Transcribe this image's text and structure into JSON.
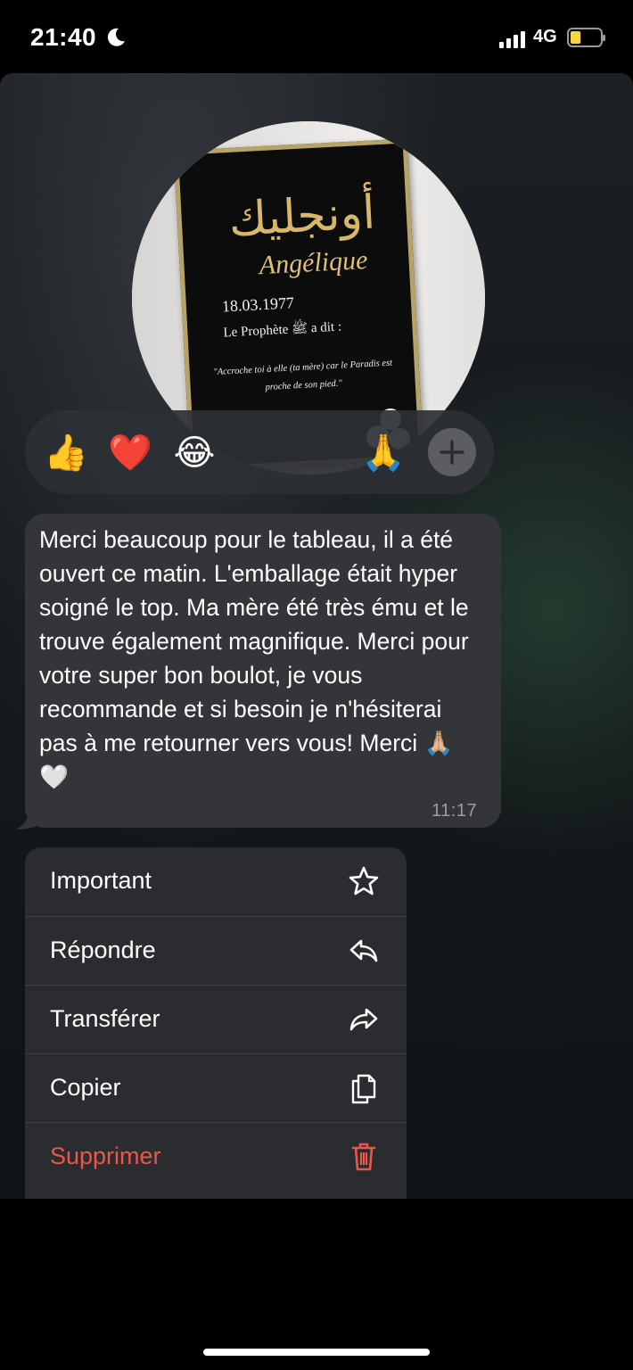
{
  "status_bar": {
    "time": "21:40",
    "network": "4G",
    "battery_level_fraction": 0.35,
    "battery_color": "#f5d547",
    "icons": [
      "moon-icon",
      "signal-icon",
      "battery-icon"
    ]
  },
  "image_preview": {
    "arabic_title": "أونجليك",
    "name": "Angélique",
    "date": "18.03.1977",
    "said_line": "Le Prophète ﷺ a dit :",
    "quote": "\"Accroche toi à elle (ta mère) car le Paradis est proche de son pied.\""
  },
  "reactions": [
    {
      "emoji": "👍",
      "name": "thumbs-up"
    },
    {
      "emoji": "❤️",
      "name": "heart"
    },
    {
      "emoji": "😂",
      "name": "tears-of-joy"
    },
    {
      "emoji": "🙏",
      "name": "folded-hands"
    }
  ],
  "message": {
    "text": "Merci beaucoup pour le tableau, il a été ouvert ce matin. L'emballage était hyper soigné le top. Ma mère été très ému et le trouve également magnifique. Merci pour votre super bon boulot, je vous recommande et si besoin je n'hésiterai pas à me retourner vers vous! Merci 🙏🏼 🤍",
    "time": "11:17"
  },
  "context_menu": {
    "items": [
      {
        "label": "Important",
        "icon": "star-icon"
      },
      {
        "label": "Répondre",
        "icon": "reply-icon"
      },
      {
        "label": "Transférer",
        "icon": "forward-icon"
      },
      {
        "label": "Copier",
        "icon": "copy-icon"
      },
      {
        "label": "Supprimer",
        "icon": "trash-icon",
        "destructive": true
      }
    ],
    "destructive_color": "#e8574d"
  }
}
